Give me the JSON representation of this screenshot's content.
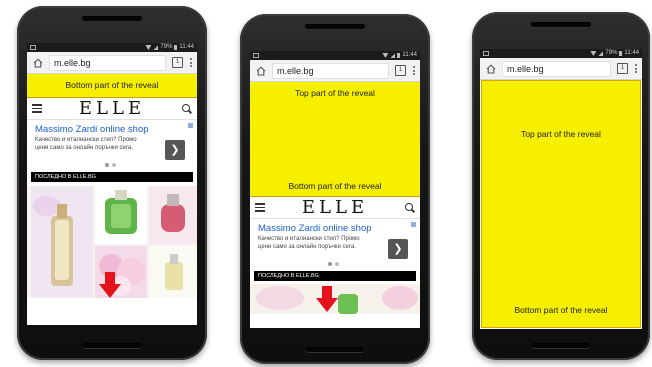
{
  "phones": [
    {
      "status_time": "11:44",
      "status_battery": "79%",
      "url": "m.elle.bg",
      "tab_count": "1",
      "reveal_label": "Bottom part of the reveal",
      "logo": "ELLE",
      "ad_title": "Massimo Zardi online shop",
      "ad_text": "Качество и италиански стил? Промо цени само за онлайн поръчки сега.",
      "ad_button": "❯",
      "section_label": "ПОСЛЕДНО В ELLE.BG"
    },
    {
      "status_time": "11:44",
      "url": "m.elle.bg",
      "tab_count": "1",
      "reveal_top": "Top part of the reveal",
      "reveal_bottom": "Bottom part of the reveal",
      "logo": "ELLE",
      "ad_title": "Massimo Zardi online shop",
      "ad_text": "Качество и италиански стил? Промо цени само за онлайн поръчки сега.",
      "ad_button": "❯",
      "section_label": "ПОСЛЕДНО В ELLE.BG"
    },
    {
      "status_time": "11:44",
      "status_battery": "79%",
      "url": "m.elle.bg",
      "tab_count": "1",
      "reveal_top": "Top part of the reveal",
      "reveal_bottom": "Bottom part of the reveal"
    }
  ],
  "colors": {
    "reveal_yellow": "#f6ef00",
    "arrow_red": "#e3121b",
    "ad_link_blue": "#1a5fd0"
  },
  "icons": [
    "home-icon",
    "tabs-icon",
    "menu-icon",
    "hamburger-icon",
    "search-icon",
    "chevron-right-icon",
    "down-arrow-icon"
  ]
}
